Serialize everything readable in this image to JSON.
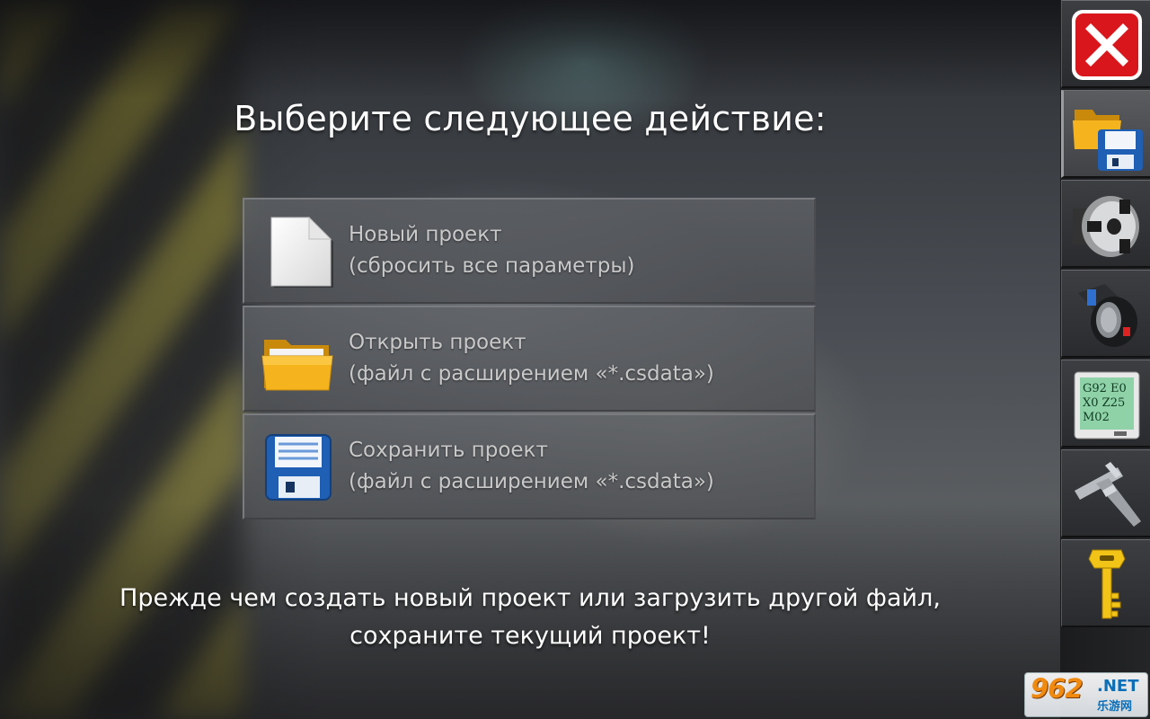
{
  "dialog": {
    "title": "Выберите следующее действие:",
    "options": [
      {
        "icon": "new-document-icon",
        "line1": "Новый проект",
        "line2": "(сбросить все параметры)"
      },
      {
        "icon": "open-folder-icon",
        "line1": "Открыть проект",
        "line2": "(файл с расширением «*.csdata»)"
      },
      {
        "icon": "floppy-disk-icon",
        "line1": "Сохранить проект",
        "line2": "(файл с расширением «*.csdata»)"
      }
    ],
    "warning_line1": "Прежде чем создать новый проект или загрузить другой файл,",
    "warning_line2": "сохраните текущий проект!"
  },
  "toolbar": {
    "items": [
      {
        "icon": "close-icon",
        "active": false
      },
      {
        "icon": "file-folder-save-icon",
        "active": true
      },
      {
        "icon": "lathe-chuck-icon",
        "active": false
      },
      {
        "icon": "tool-holder-icon",
        "active": false
      },
      {
        "icon": "gcode-monitor-icon",
        "text": "G92 E0 X0 Z25 M02",
        "active": false
      },
      {
        "icon": "caliper-icon",
        "active": false
      },
      {
        "icon": "key-icon",
        "active": false
      }
    ]
  },
  "watermark": {
    "number": "962",
    "suffix": ".NET",
    "subtitle": "乐游网"
  },
  "colors": {
    "title_text": "#ffffff",
    "option_text": "#c9c9c9",
    "close_red": "#d9161c"
  }
}
